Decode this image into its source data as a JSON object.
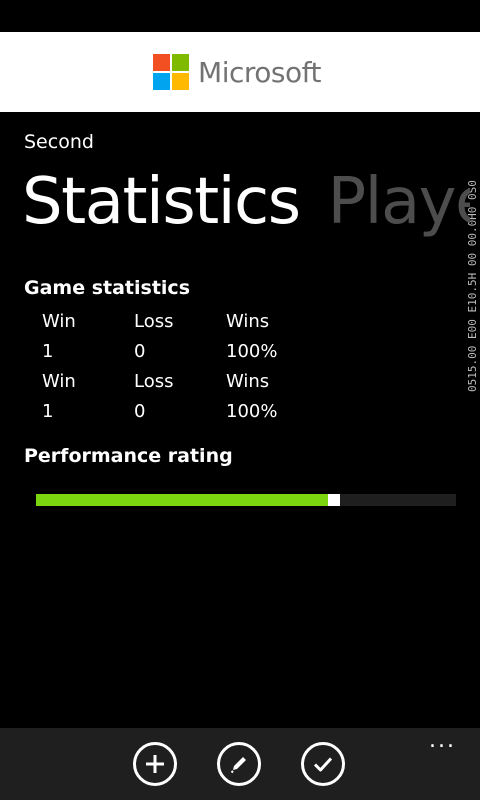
{
  "ad": {
    "brand": "Microsoft",
    "logo_colors": [
      "#f25022",
      "#7fba00",
      "#00a4ef",
      "#ffb900"
    ]
  },
  "debug_overlay": "0515.00 E00 E10.5H 00 00.0H0 0S0",
  "app": {
    "title": "Second"
  },
  "pivot": {
    "items": [
      {
        "label": "Statistics",
        "active": true
      },
      {
        "label": "Player",
        "active": false
      }
    ]
  },
  "game_statistics": {
    "title": "Game statistics",
    "rows": [
      [
        "Win",
        "Loss",
        "Wins"
      ],
      [
        "1",
        "0",
        "100%"
      ],
      [
        "Win",
        "Loss",
        "Wins"
      ],
      [
        "1",
        "0",
        "100%"
      ]
    ]
  },
  "performance": {
    "title": "Performance rating",
    "value": 0.71,
    "accent": "#7bd60f"
  },
  "app_bar": {
    "buttons": [
      {
        "icon": "add-icon"
      },
      {
        "icon": "edit-icon"
      },
      {
        "icon": "check-icon"
      }
    ],
    "more_label": "..."
  }
}
